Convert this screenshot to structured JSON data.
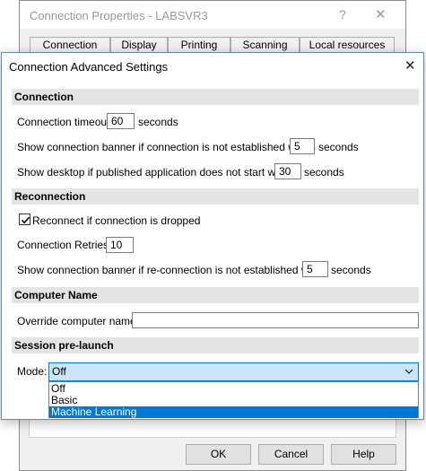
{
  "parent_dialog": {
    "title": "Connection Properties - LABSVR3",
    "help_glyph": "?",
    "close_glyph": "✕",
    "tabs": [
      "Connection",
      "Display",
      "Printing",
      "Scanning",
      "Local resources"
    ],
    "buttons": {
      "ok": "OK",
      "cancel": "Cancel",
      "help": "Help"
    }
  },
  "dialog": {
    "title": "Connection Advanced Settings",
    "close_glyph": "✕"
  },
  "connection": {
    "header": "Connection",
    "timeout_label": "Connection timeout:",
    "timeout_value": "60",
    "timeout_unit": "seconds",
    "banner_label": "Show connection banner if connection is not established within",
    "banner_value": "5",
    "banner_unit": "seconds",
    "desktop_label": "Show desktop if published application does not start within",
    "desktop_value": "30",
    "desktop_unit": "seconds"
  },
  "reconnection": {
    "header": "Reconnection",
    "reconnect_label": "Reconnect if connection is dropped",
    "reconnect_checked": true,
    "retries_label": "Connection Retries:",
    "retries_value": "10",
    "reconnect_banner_label": "Show connection banner if re-connection is not established within",
    "reconnect_banner_value": "5",
    "reconnect_banner_unit": "seconds"
  },
  "computer_name": {
    "header": "Computer Name",
    "override_label": "Override computer name:",
    "override_value": ""
  },
  "session_prelaunch": {
    "header": "Session pre-launch",
    "mode_label": "Mode:",
    "mode_value": "Off",
    "options": [
      "Off",
      "Basic",
      "Machine Learning"
    ],
    "highlighted_option": "Machine Learning"
  },
  "colors": {
    "accent": "#0078d7",
    "select_bg": "#cce4f7",
    "section_header_bg": "#e4e4e4"
  },
  "icons": {
    "checkbox_mark": "check-icon",
    "dropdown": "chevron-down-icon"
  }
}
